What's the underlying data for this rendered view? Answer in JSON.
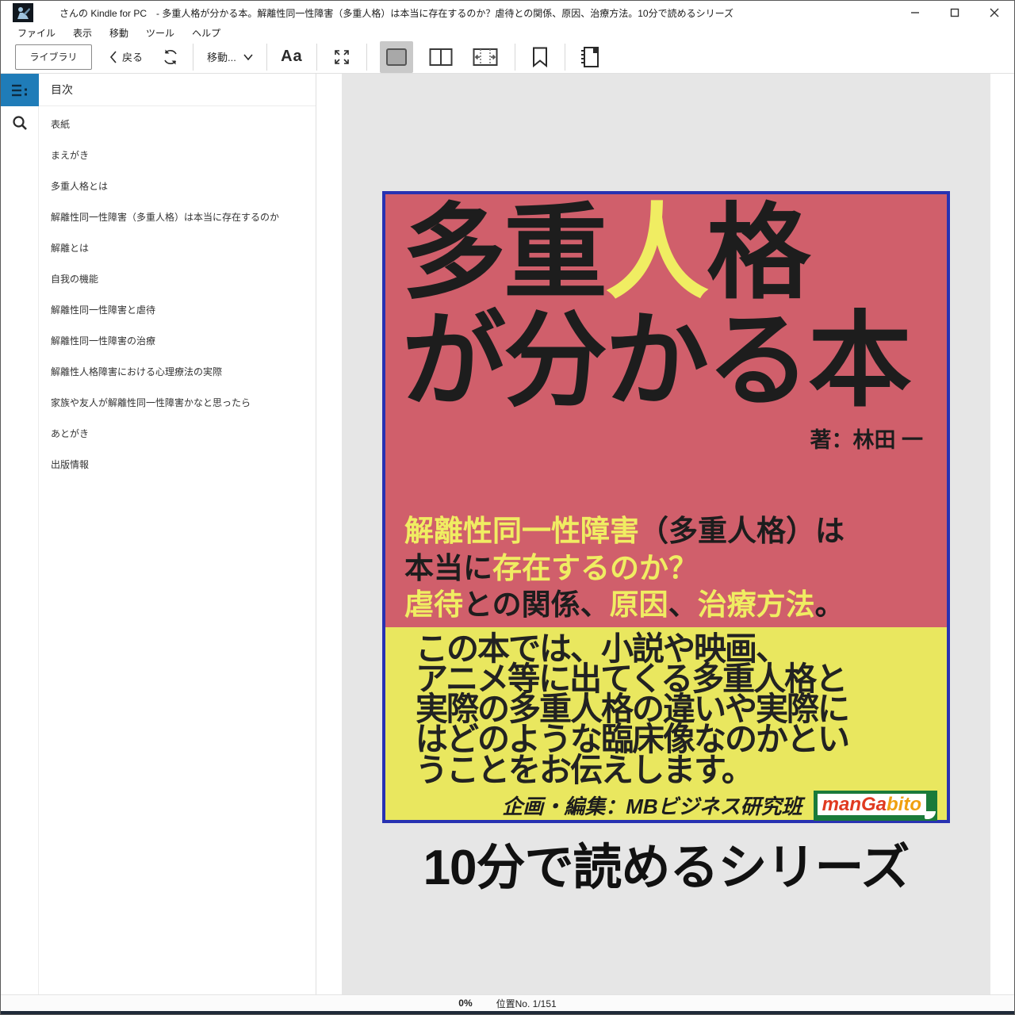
{
  "window": {
    "title": "さんの Kindle for PC　- 多重人格が分かる本。解離性同一性障害（多重人格）は本当に存在するのか？虐待との関係、原因、治療方法。10分で読めるシリーズ"
  },
  "menu": {
    "items": [
      "ファイル",
      "表示",
      "移動",
      "ツール",
      "ヘルプ"
    ]
  },
  "toolbar": {
    "library_label": "ライブラリ",
    "back_label": "戻る",
    "goto_label": "移動...",
    "font_label": "Aa"
  },
  "sidebar": {
    "header": "目次",
    "items": [
      "表紙",
      "まえがき",
      "多重人格とは",
      "解離性同一性障害（多重人格）は本当に存在するのか",
      "解離とは",
      "自我の機能",
      "解離性同一性障害と虐待",
      "解離性同一性障害の治療",
      "解離性人格障害における心理療法の実際",
      "家族や友人が解離性同一性障害かなと思ったら",
      "あとがき",
      "出版情報"
    ]
  },
  "cover": {
    "title_lines": [
      {
        "segments": [
          {
            "text": "多重",
            "color": "black"
          },
          {
            "text": "人",
            "color": "yellow"
          },
          {
            "text": "格",
            "color": "black"
          }
        ]
      },
      {
        "segments": [
          {
            "text": "が分かる本",
            "color": "black"
          }
        ]
      }
    ],
    "author": "著：林田 一",
    "subtitle_lines": [
      {
        "segments": [
          {
            "text": "解離性同一性障害",
            "color": "yellow"
          },
          {
            "text": "（多重人格）は",
            "color": "black"
          }
        ]
      },
      {
        "segments": [
          {
            "text": "本当に",
            "color": "black"
          },
          {
            "text": "存在するのか？",
            "color": "yellow"
          }
        ]
      },
      {
        "segments": [
          {
            "text": "虐待",
            "color": "yellow"
          },
          {
            "text": "との関係、",
            "color": "black"
          },
          {
            "text": "原因",
            "color": "yellow"
          },
          {
            "text": "、",
            "color": "black"
          },
          {
            "text": "治療方法",
            "color": "yellow"
          },
          {
            "text": "。",
            "color": "black"
          }
        ]
      }
    ],
    "description_lines": [
      "この本では、小説や映画、",
      "アニメ等に出てくる多重人格と",
      "実際の多重人格の違いや実際に",
      "はどのような臨床像なのかとい",
      "うことをお伝えします。"
    ],
    "credit": "企画・編集：MBビジネス研究班",
    "logo": {
      "part1": "manGa",
      "part2": "bito"
    }
  },
  "series_title": "10分で読めるシリーズ",
  "status": {
    "percent": "0%",
    "location": "位置No. 1/151"
  },
  "colors": {
    "rail_active_blue": "#1f7cb8",
    "cover_pink": "#d05f6b",
    "cover_border_blue": "#2832b2",
    "cover_yellow_text": "#f0ed62",
    "cover_yellow_box": "#e9e75f",
    "logo_green": "#1a7a3a",
    "logo_red": "#e03a20",
    "logo_orange": "#f0a010"
  }
}
